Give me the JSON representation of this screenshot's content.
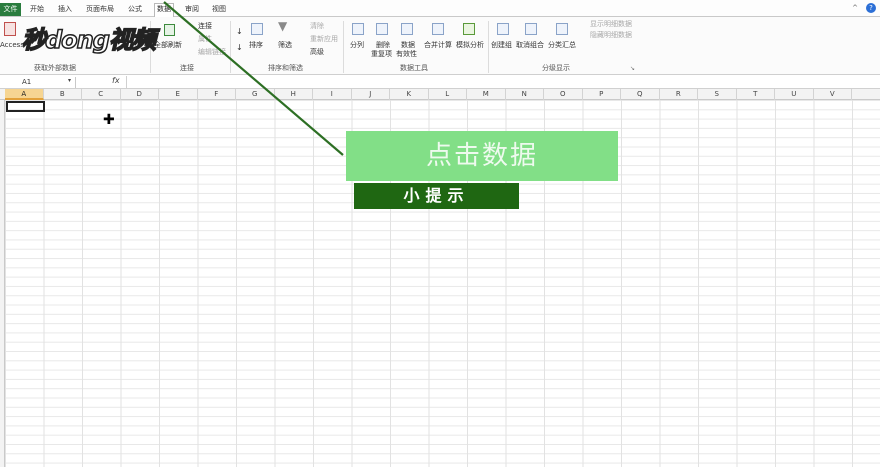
{
  "menubar": {
    "file_label": "文件",
    "tabs": [
      {
        "label": "开始"
      },
      {
        "label": "插入"
      },
      {
        "label": "页面布局"
      },
      {
        "label": "公式"
      },
      {
        "label": "数据",
        "active": true
      },
      {
        "label": "审阅"
      },
      {
        "label": "视图"
      }
    ],
    "window_controls": "^",
    "help": "?"
  },
  "ribbon": {
    "access_label": "Access",
    "refresh_all_label": "全部刷新",
    "connections_label": "连接",
    "properties_label": "属性",
    "edit_links_label": "编辑链接",
    "sort_label": "排序",
    "filter_label": "筛选",
    "clear_label": "清除",
    "reapply_label": "重新应用",
    "advanced_label": "高级",
    "text_to_columns_label": "分列",
    "remove_dup_label_1": "删除",
    "remove_dup_label_2": "重复项",
    "data_valid_label_1": "数据",
    "data_valid_label_2": "有效性",
    "consolidate_label": "合并计算",
    "whatif_label": "模拟分析",
    "group_label": "创建组",
    "ungroup_label": "取消组合",
    "subtotal_label": "分类汇总",
    "show_detail_label": "显示明细数据",
    "hide_detail_label": "隐藏明细数据",
    "groups": {
      "get_external": "获取外部数据",
      "connections": "连接",
      "sort_filter": "排序和筛选",
      "data_tools": "数据工具",
      "outline": "分级显示"
    }
  },
  "watermark": {
    "text": "秒dong视频"
  },
  "formula_bar": {
    "name_box": "A1",
    "fx": "fx",
    "value": ""
  },
  "columns": [
    "A",
    "B",
    "C",
    "D",
    "E",
    "F",
    "G",
    "H",
    "I",
    "J",
    "K",
    "L",
    "M",
    "N",
    "O",
    "P",
    "Q",
    "R",
    "S",
    "T",
    "U",
    "V"
  ],
  "selected_cell": "A1",
  "callout": {
    "text": "点击数据"
  },
  "tip": {
    "text": "小提示"
  },
  "colors": {
    "file_tab": "#2a7c3e",
    "callout_bg": "#82df87",
    "tip_bg": "#1f6712",
    "pointer_line": "#2d6f24",
    "selected_header": "#f6d592"
  }
}
